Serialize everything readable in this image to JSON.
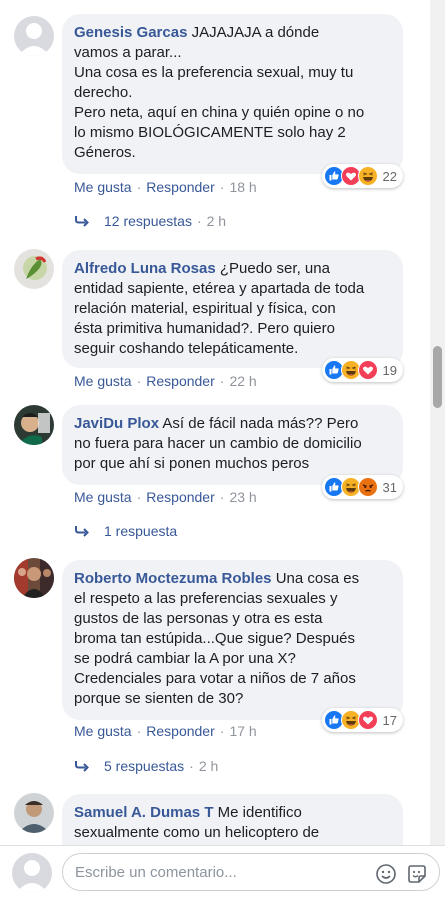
{
  "comments": [
    {
      "author": "Genesis Garcas",
      "text": " JAJAJAJA a dónde\nvamos a parar...\nUna cosa es la preferencia sexual, muy tu\nderecho.\nPero neta, aquí en china y quién opine o no\nlo mismo BIOLÓGICAMENTE solo hay 2\nGéneros.",
      "reactions": [
        "like",
        "love",
        "haha"
      ],
      "reaction_count": "22",
      "like_label": "Me gusta",
      "reply_label": "Responder",
      "time": "18 h",
      "replies_label": "12 respuestas",
      "replies_time": "2 h"
    },
    {
      "author": "Alfredo Luna Rosas",
      "text": " ¿Puedo ser, una\nentidad sapiente, etérea y apartada de toda\nrelación material, espiritual y física, con\nésta primitiva humanidad?. Pero quiero\nseguir coshando telepáticamente.",
      "reactions": [
        "like",
        "haha",
        "love"
      ],
      "reaction_count": "19",
      "like_label": "Me gusta",
      "reply_label": "Responder",
      "time": "22 h"
    },
    {
      "author": "JaviDu Plox",
      "text": " Así de fácil nada más?? Pero\nno fuera para hacer un cambio de domicilio\npor que ahí si ponen muchos peros",
      "reactions": [
        "like",
        "haha",
        "angry"
      ],
      "reaction_count": "31",
      "like_label": "Me gusta",
      "reply_label": "Responder",
      "time": "23 h",
      "replies_label": "1 respuesta",
      "replies_time": ""
    },
    {
      "author": "Roberto Moctezuma Robles",
      "text": " Una cosa es\nel respeto a las preferencias sexuales y\ngustos de las personas y otra es esta\nbroma tan estúpida...Que sigue? Después\nse podrá cambiar la A por una X?\nCredenciales para votar a niños de 7 años\nporque se sienten de 30?",
      "reactions": [
        "like",
        "haha",
        "love"
      ],
      "reaction_count": "17",
      "like_label": "Me gusta",
      "reply_label": "Responder",
      "time": "17 h",
      "replies_label": "5 respuestas",
      "replies_time": "2 h"
    },
    {
      "author": "Samuel A. Dumas T",
      "text": " Me identifico\nsexualmente como un helicoptero de"
    }
  ],
  "composer": {
    "placeholder": "Escribe un comentario...",
    "emoji_icon": "emoji-icon",
    "sticker_icon": "sticker-icon"
  },
  "colors": {
    "author_blue": "#385898",
    "bubble_bg": "#f0f2f5",
    "meta_gray": "#90949c",
    "like_blue": "#1877f2",
    "love_red": "#f33e58",
    "haha_yellow": "#f7b125",
    "angry_orange": "#e9710f"
  }
}
